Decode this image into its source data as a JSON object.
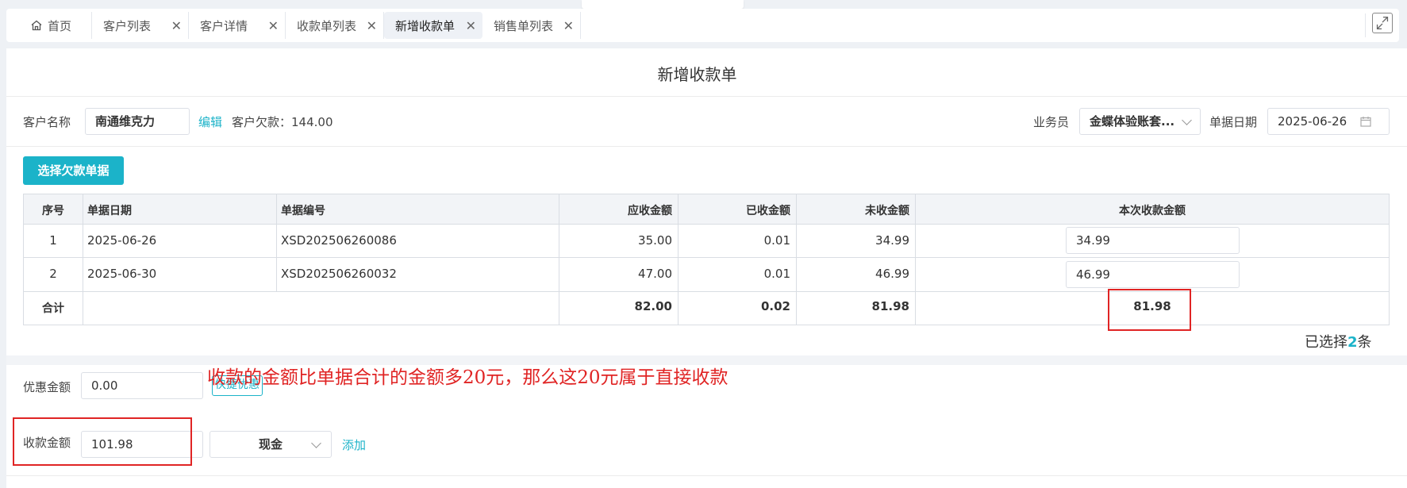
{
  "tabs": [
    {
      "label": "首页",
      "closable": false,
      "active": false
    },
    {
      "label": "客户列表",
      "closable": true,
      "active": false
    },
    {
      "label": "客户详情",
      "closable": true,
      "active": false
    },
    {
      "label": "收款单列表",
      "closable": true,
      "active": false
    },
    {
      "label": "新增收款单",
      "closable": true,
      "active": true
    },
    {
      "label": "销售单列表",
      "closable": true,
      "active": false
    }
  ],
  "close_glyph": "✕",
  "page_title": "新增收款单",
  "form": {
    "customer_label": "客户名称",
    "customer_value": "南通维克力",
    "edit_link": "编辑",
    "debt_text": "客户欠款：144.00",
    "salesperson_label": "业务员",
    "salesperson_value": "金蝶体验账套...",
    "date_label": "单据日期",
    "date_value": "2025-06-26"
  },
  "select_debt_button": "选择欠款单据",
  "table": {
    "headers": {
      "seq": "序号",
      "date": "单据日期",
      "number": "单据编号",
      "receivable": "应收金额",
      "received": "已收金额",
      "unreceived": "未收金额",
      "this_time": "本次收款金额"
    },
    "rows": [
      {
        "seq": "1",
        "date": "2025-06-26",
        "number": "XSD202506260086",
        "receivable": "35.00",
        "received": "0.01",
        "unreceived": "34.99",
        "this_time": "34.99"
      },
      {
        "seq": "2",
        "date": "2025-06-30",
        "number": "XSD202506260032",
        "receivable": "47.00",
        "received": "0.01",
        "unreceived": "46.99",
        "this_time": "46.99"
      }
    ],
    "total": {
      "label": "合计",
      "receivable": "82.00",
      "received": "0.02",
      "unreceived": "81.98",
      "this_time": "81.98"
    }
  },
  "selected": {
    "prefix": "已选择",
    "count": "2",
    "suffix": "条"
  },
  "discount": {
    "label": "优惠金额",
    "value": "0.00",
    "quick_button": "快捷优惠"
  },
  "payment": {
    "label": "收款金额",
    "value": "101.98",
    "method": "现金",
    "add_link": "添加"
  },
  "annotation": "收款的金额比单据合计的金额多20元，那么这20元属于直接收款",
  "colors": {
    "accent": "#1bb3c9",
    "annotation_red": "#e02424"
  }
}
